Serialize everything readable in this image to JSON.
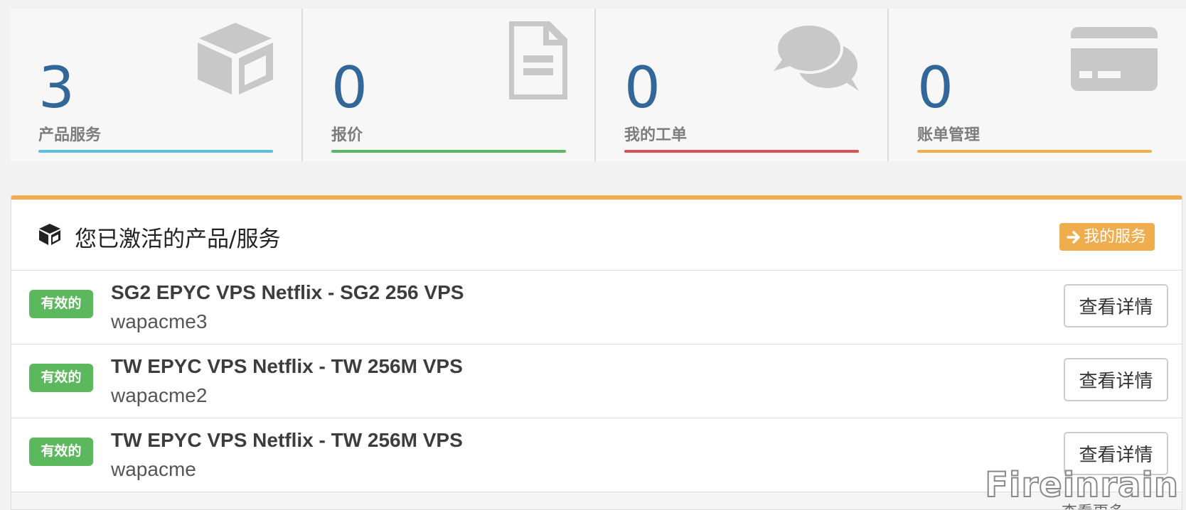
{
  "tiles": [
    {
      "count": "3",
      "label": "产品服务",
      "bar_color": "#5bc0de",
      "icon": "cube-icon"
    },
    {
      "count": "0",
      "label": "报价",
      "bar_color": "#5cb85c",
      "icon": "file-text-icon"
    },
    {
      "count": "0",
      "label": "我的工单",
      "bar_color": "#d9534f",
      "icon": "comments-icon"
    },
    {
      "count": "0",
      "label": "账单管理",
      "bar_color": "#f0ad4e",
      "icon": "credit-card-icon"
    }
  ],
  "panel": {
    "title": "您已激活的产品/服务",
    "title_icon": "cube-icon",
    "my_services_label": "我的服务",
    "my_services_icon": "arrow-right-icon",
    "accent_color": "#f0ad4e",
    "more_label": "查看更多..."
  },
  "services": [
    {
      "status": "有效的",
      "name": "SG2 EPYC VPS Netflix - SG2 256 VPS",
      "hostname": "wapacme3",
      "button": "查看详情"
    },
    {
      "status": "有效的",
      "name": "TW EPYC VPS Netflix - TW 256M VPS",
      "hostname": "wapacme2",
      "button": "查看详情"
    },
    {
      "status": "有效的",
      "name": "TW EPYC VPS Netflix - TW 256M VPS",
      "hostname": "wapacme",
      "button": "查看详情"
    }
  ],
  "watermark": "Fireinrain",
  "colors": {
    "count_text": "#336699",
    "status_active": "#5cb85c",
    "icon_gray": "#c8c8c8"
  }
}
